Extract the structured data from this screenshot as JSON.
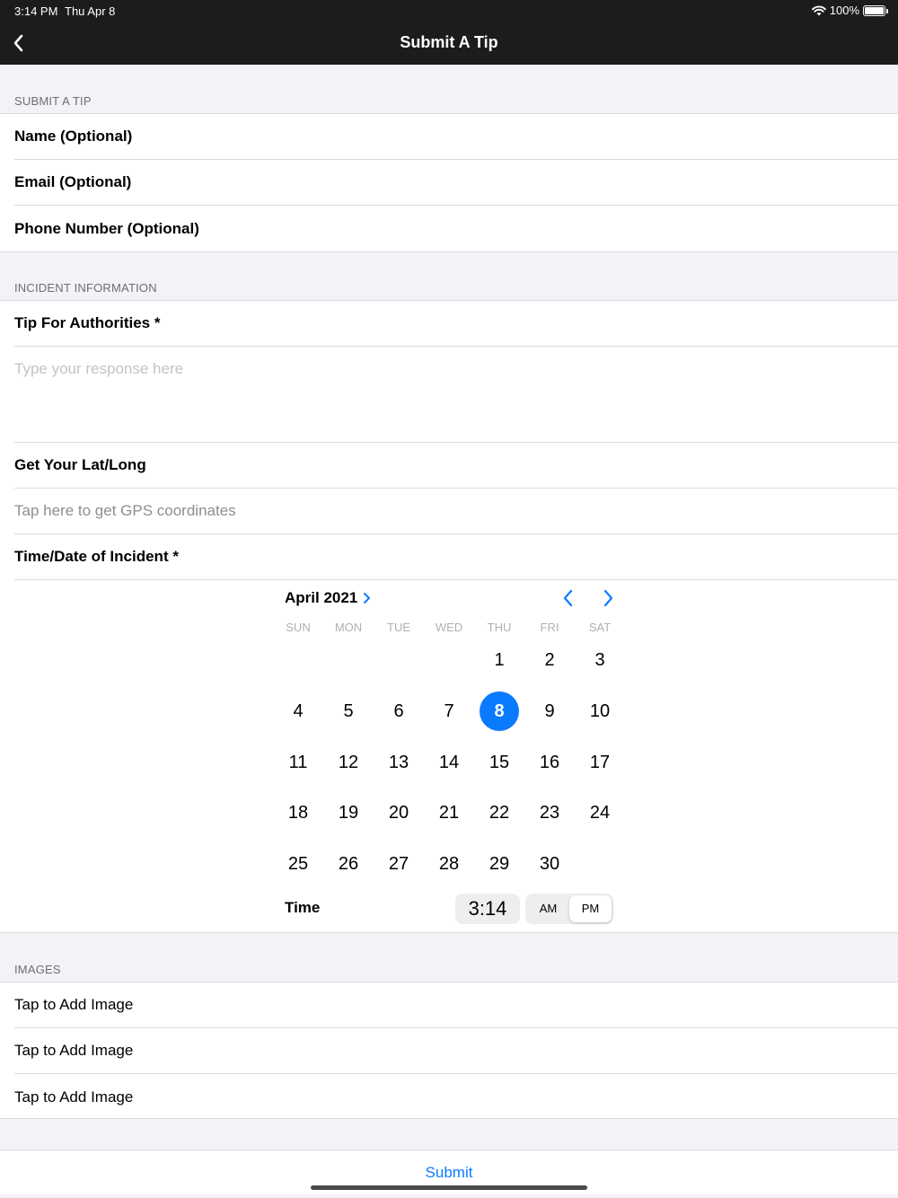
{
  "status": {
    "time": "3:14 PM",
    "date": "Thu Apr 8",
    "battery": "100%",
    "battery_level": 1.0
  },
  "nav": {
    "title": "Submit A Tip"
  },
  "tip_section": {
    "header": "SUBMIT A TIP",
    "fields": [
      "Name (Optional)",
      "Email (Optional)",
      "Phone Number (Optional)"
    ]
  },
  "incident_section": {
    "header": "INCIDENT INFORMATION",
    "tip_label": "Tip For Authorities *",
    "tip_placeholder": "Type your response here",
    "gps_label": "Get Your Lat/Long",
    "gps_action": "Tap here to get GPS coordinates",
    "datetime_label": "Time/Date of Incident *"
  },
  "calendar": {
    "month": "April 2021",
    "weekdays": [
      "SUN",
      "MON",
      "TUE",
      "WED",
      "THU",
      "FRI",
      "SAT"
    ],
    "first_weekday_index": 4,
    "days_in_month": 30,
    "selected_day": 8,
    "time_label": "Time",
    "time_value": "3:14",
    "am_label": "AM",
    "pm_label": "PM",
    "period": "PM"
  },
  "images_section": {
    "header": "IMAGES",
    "items": [
      "Tap to Add Image",
      "Tap to Add Image",
      "Tap to Add Image"
    ]
  },
  "submit_label": "Submit",
  "colors": {
    "accent": "#0a7aff",
    "bar": "#1c1c1e"
  }
}
